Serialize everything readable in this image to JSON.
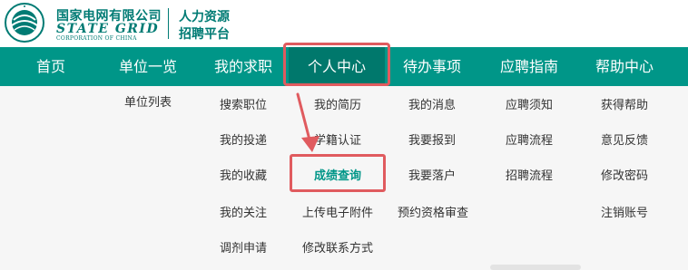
{
  "brand": {
    "org_cn": "国家电网有限公司",
    "org_en": "STATE GRID",
    "org_en_sub": "CORPORATION OF CHINA",
    "system_line1": "人力资源",
    "system_line2": "招聘平台",
    "brand_color": "#007b74"
  },
  "nav": {
    "items": [
      {
        "label": "首页"
      },
      {
        "label": "单位一览"
      },
      {
        "label": "我的求职"
      },
      {
        "label": "个人中心",
        "active": true
      },
      {
        "label": "待办事项"
      },
      {
        "label": "应聘指南"
      },
      {
        "label": "帮助中心"
      }
    ],
    "bar_color": "#009688",
    "active_color": "#00786c"
  },
  "menus": {
    "units": [
      "单位列表"
    ],
    "job_search": [
      "搜索职位",
      "我的投递",
      "我的收藏",
      "我的关注",
      "调剂申请"
    ],
    "personal": [
      "我的简历",
      "学籍认证",
      "成绩查询",
      "上传电子附件",
      "修改联系方式"
    ],
    "todo": [
      "我的消息",
      "我要报到",
      "我要落户",
      "预约资格审查"
    ],
    "guide": [
      "应聘须知",
      "应聘流程",
      "招聘流程"
    ],
    "help": [
      "获得帮助",
      "意见反馈",
      "修改密码",
      "注销账号"
    ]
  },
  "annotation": {
    "highlight_color": "#e05b5f",
    "selected_item": "成绩查询"
  }
}
